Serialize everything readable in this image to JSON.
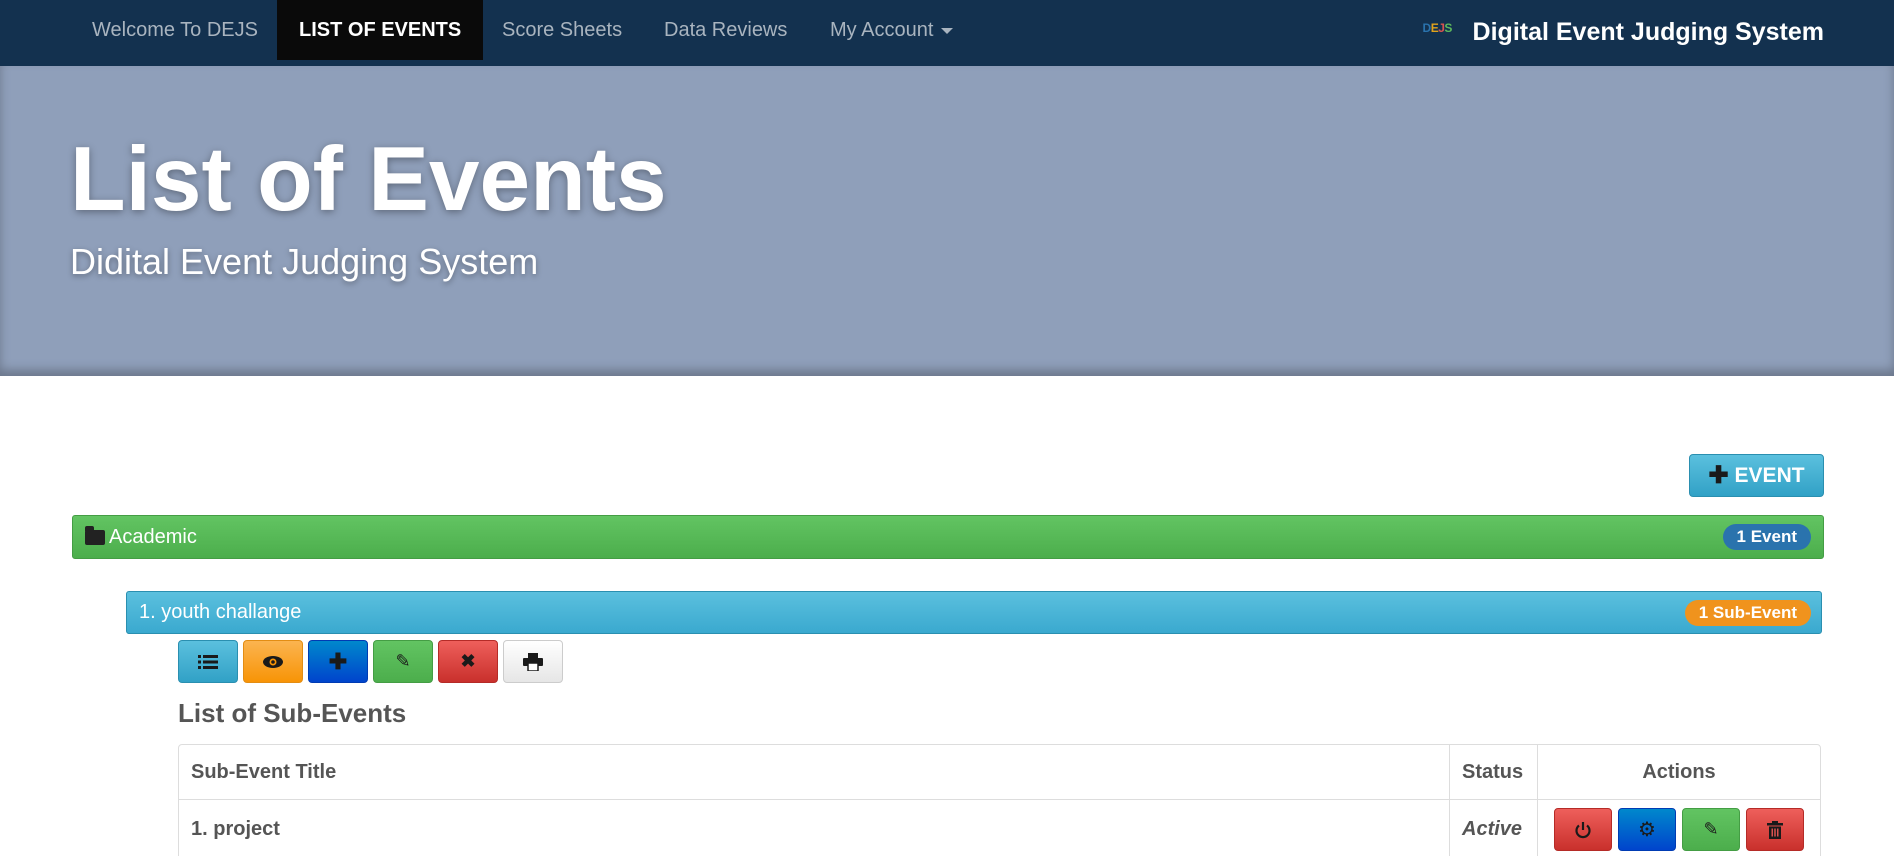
{
  "nav": {
    "items": [
      {
        "label": "Welcome To DEJS"
      },
      {
        "label": "LIST OF EVENTS"
      },
      {
        "label": "Score Sheets"
      },
      {
        "label": "Data Reviews"
      },
      {
        "label": "My Account"
      }
    ],
    "brand_logo": "DEJS",
    "brand_title": "Digital Event Judging System"
  },
  "jumbotron": {
    "title": "List of Events",
    "subtitle": "Didital Event Judging System"
  },
  "add_event_button": {
    "label": "EVENT",
    "icon": "plus-icon"
  },
  "category": {
    "label": "Academic",
    "icon": "folder-icon",
    "badge": "1 Event"
  },
  "event": {
    "label": "1. youth challange",
    "badge": "1 Sub-Event"
  },
  "tool_buttons": [
    {
      "icon": "list-icon"
    },
    {
      "icon": "eye-icon"
    },
    {
      "icon": "plus-icon"
    },
    {
      "icon": "pencil-icon"
    },
    {
      "icon": "close-icon"
    },
    {
      "icon": "print-icon"
    }
  ],
  "sub_events": {
    "heading": "List of Sub-Events",
    "columns": [
      "Sub-Event Title",
      "Status",
      "Actions"
    ],
    "rows": [
      {
        "title": "1. project",
        "status": "Active"
      }
    ],
    "row_actions": [
      {
        "icon": "power-icon"
      },
      {
        "icon": "gear-icon"
      },
      {
        "icon": "pencil-icon"
      },
      {
        "icon": "trash-icon"
      }
    ]
  },
  "colors": {
    "navbar": "#13314f",
    "jumbotron": "#8f9fba",
    "success": "#5cb85c",
    "info": "#5bc0de",
    "warning": "#f89406",
    "primary": "#0055cc",
    "danger": "#d9534f"
  }
}
